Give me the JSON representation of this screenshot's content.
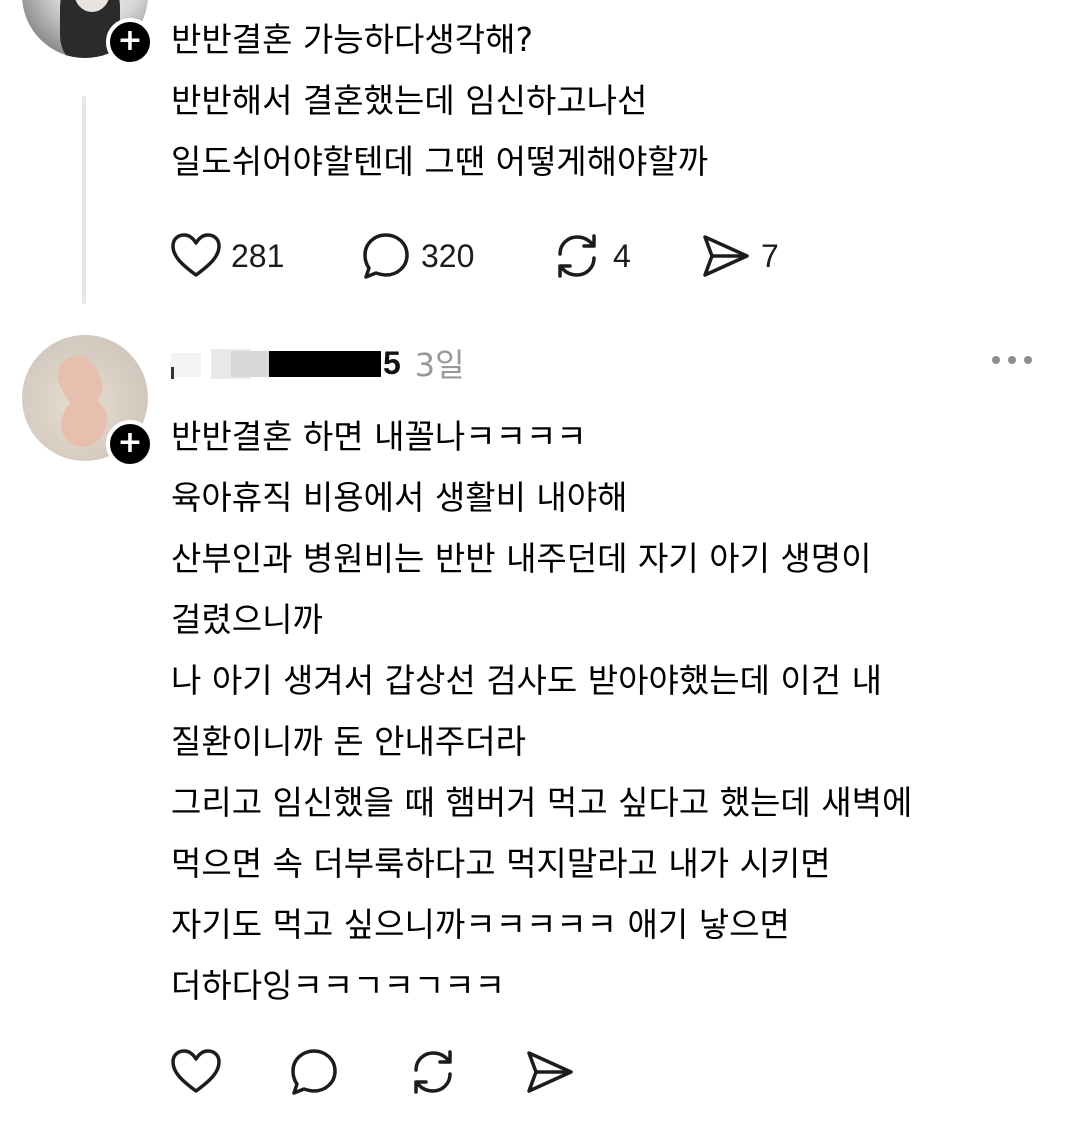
{
  "posts": [
    {
      "avatar_badge": "+",
      "text_lines": [
        "반반결혼 가능하다생각해?",
        "반반해서 결혼했는데 임신하고나선",
        "일도쉬어야할텐데 그땐 어떻게해야할까"
      ],
      "actions": {
        "like_count": "281",
        "reply_count": "320",
        "repost_count": "4",
        "share_count": "7"
      }
    },
    {
      "avatar_badge": "+",
      "username_suffix": "5",
      "timestamp": "3일",
      "text_lines": [
        "반반결혼 하면 내꼴나ㅋㅋㅋㅋ",
        "육아휴직 비용에서 생활비 내야해",
        "산부인과 병원비는 반반 내주던데 자기 아기 생명이",
        "걸렸으니까",
        "나 아기 생겨서 갑상선 검사도 받아야했는데 이건 내",
        "질환이니까 돈 안내주더라",
        "그리고 임신했을 때 햄버거 먹고 싶다고 했는데 새벽에",
        "먹으면 속 더부룩하다고 먹지말라고 내가 시키면",
        "자기도 먹고 싶으니까ㅋㅋㅋㅋㅋ 애기 낳으면",
        "더하다잉ㅋㅋㄱㅋㄱㅋㅋ"
      ]
    }
  ],
  "icons": {
    "like": "heart-icon",
    "reply": "comment-icon",
    "repost": "repost-icon",
    "share": "send-icon",
    "more": "more-icon",
    "follow": "plus-icon"
  },
  "colors": {
    "text": "#000000",
    "timestamp": "#999999",
    "thread_line": "#e6e6e6",
    "icon": "#1c1c1c"
  }
}
